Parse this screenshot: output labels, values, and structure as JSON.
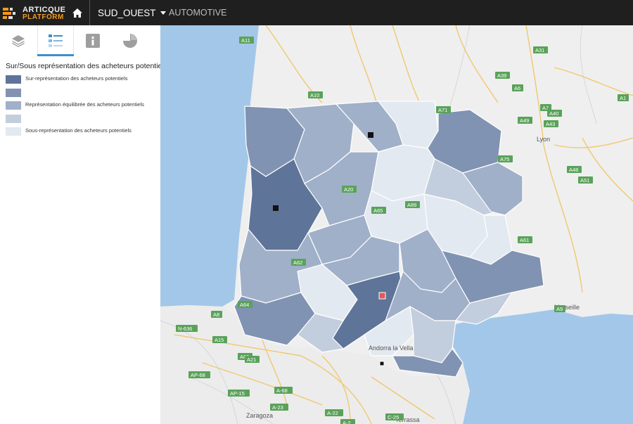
{
  "header": {
    "logo_line1": "ARTICQUE",
    "logo_line2": "PLATFORM",
    "study": "SUD_OUEST",
    "module": "AUTOMOTIVE"
  },
  "sidebar": {
    "tabs": [
      {
        "icon": "layers-icon",
        "active": false
      },
      {
        "icon": "legend-list-icon",
        "active": true
      },
      {
        "icon": "info-icon",
        "active": false
      },
      {
        "icon": "pie-chart-icon",
        "active": false
      }
    ],
    "legend_title": "Sur/Sous représentation des acheteurs potentiels",
    "legend_items": [
      {
        "color": "#5e7499",
        "label": "Sur-représentation des acheteurs potentiels"
      },
      {
        "color": "#8193b2",
        "label": ""
      },
      {
        "color": "#a0b0c9",
        "label": "Représentation équilibrée des acheteurs potentiels"
      },
      {
        "color": "#c2cedd",
        "label": ""
      },
      {
        "color": "#e3e9f1",
        "label": "Sous-représentation des acheteurs potentiels"
      }
    ]
  },
  "map": {
    "place_labels": [
      "Andorra la Vella",
      "Zaragoza",
      "Lyon",
      "Marseille",
      "Terrassa"
    ],
    "road_labels": [
      "A11",
      "A10",
      "A20",
      "A62",
      "A89",
      "A71",
      "A75",
      "A7",
      "A9",
      "A61",
      "A64",
      "A63",
      "A65",
      "A8",
      "A1",
      "A15",
      "A21",
      "AP-68",
      "AP-15",
      "A-23",
      "A-68",
      "A-22",
      "A-2",
      "N-636",
      "C-25",
      "A6",
      "A40",
      "A43",
      "A48",
      "A51",
      "A49",
      "A39",
      "A31"
    ]
  }
}
